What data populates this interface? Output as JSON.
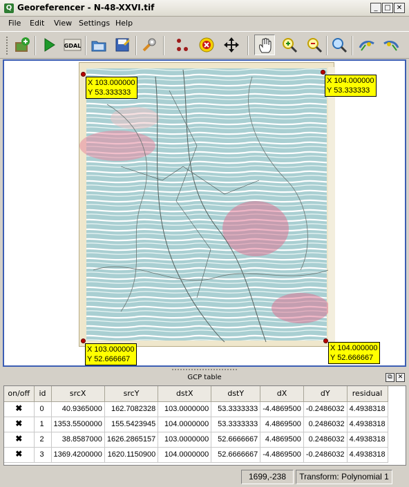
{
  "window": {
    "title": "Georeferencer - N-48-XXVI.tif",
    "minimize": "_",
    "maximize": "□",
    "close": "✕",
    "app_icon_letter": "Q"
  },
  "menu": [
    "File",
    "Edit",
    "View",
    "Settings",
    "Help"
  ],
  "toolbar": {
    "buttons": [
      {
        "name": "open-raster-icon"
      },
      {
        "name": "start-georeferencing-icon"
      },
      {
        "name": "generate-gdal-script-icon",
        "text": "GDAL"
      },
      {
        "name": "load-gcp-points-icon"
      },
      {
        "name": "save-gcp-points-icon"
      },
      {
        "name": "transformation-settings-icon"
      },
      {
        "name": "add-point-icon"
      },
      {
        "name": "delete-point-icon"
      },
      {
        "name": "move-gcp-point-icon"
      },
      {
        "name": "pan-icon"
      },
      {
        "name": "zoom-in-icon"
      },
      {
        "name": "zoom-out-icon"
      },
      {
        "name": "zoom-to-layer-icon"
      },
      {
        "name": "zoom-last-icon"
      },
      {
        "name": "zoom-next-icon"
      }
    ]
  },
  "gcp_labels": [
    {
      "x": "X 103.000000",
      "y": "Y 53.333333"
    },
    {
      "x": "X 104.000000",
      "y": "Y 53.333333"
    },
    {
      "x": "X 103.000000",
      "y": "Y 52.666667"
    },
    {
      "x": "X 104.000000",
      "y": "Y 52.666667"
    }
  ],
  "gcp_table": {
    "title": "GCP table",
    "columns": [
      "on/off",
      "id",
      "srcX",
      "srcY",
      "dstX",
      "dstY",
      "dX",
      "dY",
      "residual"
    ],
    "rows": [
      {
        "enabled": "✖",
        "id": "0",
        "srcX": "40.9365000",
        "srcY": "162.7082328",
        "dstX": "103.0000000",
        "dstY": "53.3333333",
        "dX": "-4.4869500",
        "dY": "-0.2486032",
        "residual": "4.4938318"
      },
      {
        "enabled": "✖",
        "id": "1",
        "srcX": "1353.5500000",
        "srcY": "155.5423945",
        "dstX": "104.0000000",
        "dstY": "53.3333333",
        "dX": "4.4869500",
        "dY": "0.2486032",
        "residual": "4.4938318"
      },
      {
        "enabled": "✖",
        "id": "2",
        "srcX": "38.8587000",
        "srcY": "1626.2865157",
        "dstX": "103.0000000",
        "dstY": "52.6666667",
        "dX": "4.4869500",
        "dY": "0.2486032",
        "residual": "4.4938318"
      },
      {
        "enabled": "✖",
        "id": "3",
        "srcX": "1369.4200000",
        "srcY": "1620.1150900",
        "dstX": "104.0000000",
        "dstY": "52.6666667",
        "dX": "-4.4869500",
        "dY": "-0.2486032",
        "residual": "4.4938318"
      }
    ],
    "float_btn": "⧉",
    "close_btn": "✕"
  },
  "status": {
    "coordinates": "1699,-238",
    "transform": "Transform: Polynomial 1"
  }
}
